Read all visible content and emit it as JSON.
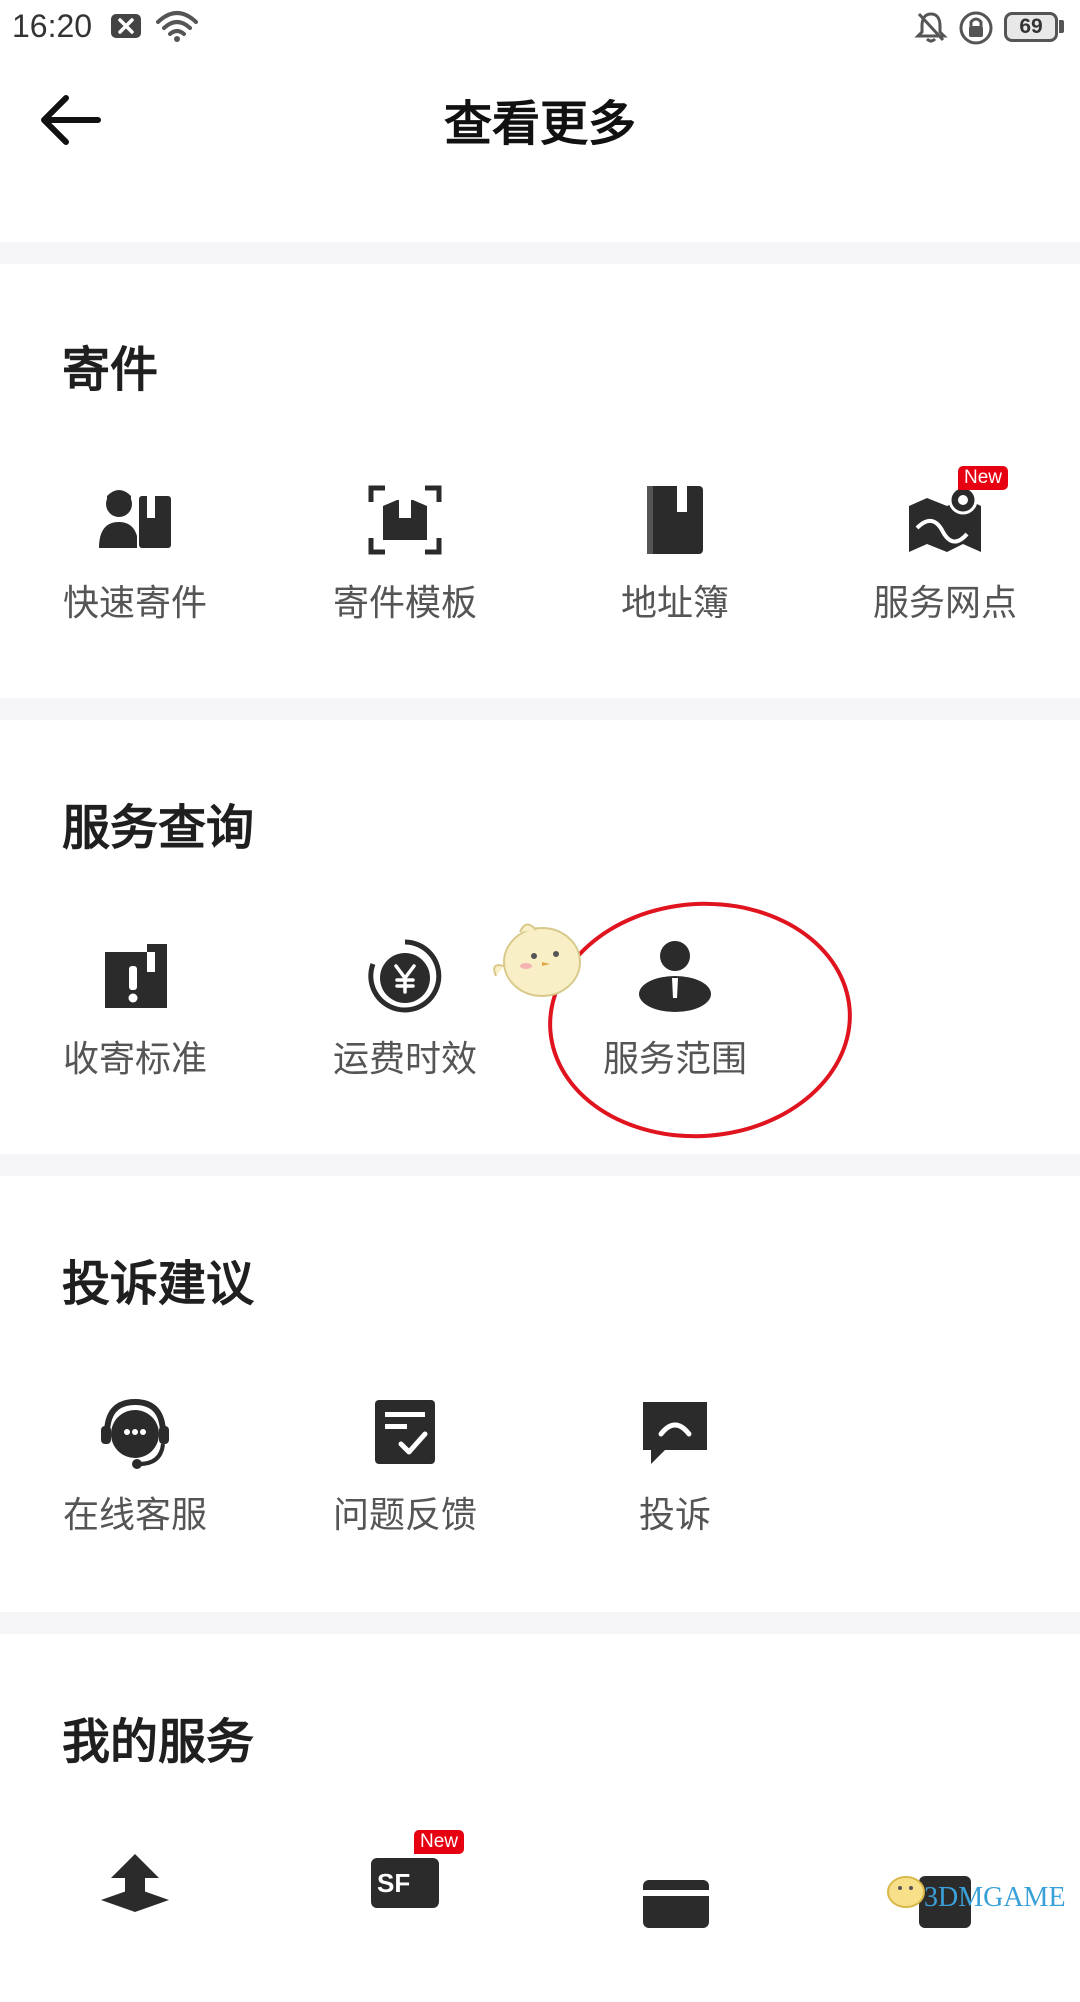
{
  "status_bar": {
    "time": "16:20",
    "battery": "69"
  },
  "header": {
    "title": "查看更多"
  },
  "sections": [
    {
      "title": "寄件",
      "items": [
        {
          "label": "快速寄件",
          "icon": "courier-package-icon"
        },
        {
          "label": "寄件模板",
          "icon": "template-scan-icon"
        },
        {
          "label": "地址簿",
          "icon": "address-book-icon"
        },
        {
          "label": "服务网点",
          "icon": "map-pin-icon",
          "badge": "New"
        }
      ]
    },
    {
      "title": "服务查询",
      "items": [
        {
          "label": "收寄标准",
          "icon": "alert-box-icon"
        },
        {
          "label": "运费时效",
          "icon": "yen-clock-icon"
        },
        {
          "label": "服务范围",
          "icon": "person-map-icon"
        }
      ]
    },
    {
      "title": "投诉建议",
      "items": [
        {
          "label": "在线客服",
          "icon": "headset-icon"
        },
        {
          "label": "问题反馈",
          "icon": "feedback-check-icon"
        },
        {
          "label": "投诉",
          "icon": "complaint-bubble-icon"
        }
      ]
    },
    {
      "title": "我的服务",
      "items": [
        {
          "label": "",
          "icon": "box-upload-icon"
        },
        {
          "label": "",
          "icon": "sf-card-icon",
          "badge": "New"
        },
        {
          "label": "",
          "icon": "card-icon"
        },
        {
          "label": "",
          "icon": "service-icon"
        }
      ]
    }
  ],
  "watermark": {
    "text": "3DMGAME"
  },
  "colors": {
    "accent_red": "#e60012",
    "icon_dark": "#2b2b2b",
    "divider": "#f5f5f7"
  }
}
